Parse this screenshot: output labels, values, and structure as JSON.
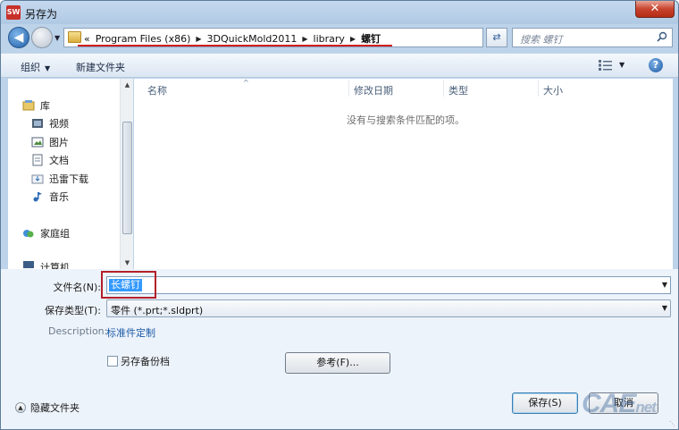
{
  "window": {
    "title": "另存为",
    "app_icon": "SW",
    "close_glyph": "✕"
  },
  "address": {
    "chevron": "«",
    "crumbs": [
      "Program Files (x86)",
      "3DQuickMold2011",
      "library",
      "螺钉"
    ],
    "search_placeholder": "搜索 螺钉"
  },
  "toolbar": {
    "organize_label": "组织",
    "new_folder_label": "新建文件夹",
    "help_glyph": "?"
  },
  "nav": {
    "items": [
      {
        "label": "库",
        "icon": "library-icon"
      },
      {
        "label": "视频",
        "icon": "video-icon"
      },
      {
        "label": "图片",
        "icon": "pictures-icon"
      },
      {
        "label": "文档",
        "icon": "documents-icon"
      },
      {
        "label": "迅雷下载",
        "icon": "download-folder-icon"
      },
      {
        "label": "音乐",
        "icon": "music-icon"
      },
      {
        "label": "家庭组",
        "icon": "homegroup-icon"
      },
      {
        "label": "计算机",
        "icon": "computer-icon"
      }
    ]
  },
  "files": {
    "columns": [
      "名称",
      "修改日期",
      "类型",
      "大小"
    ],
    "empty_message": "没有与搜索条件匹配的项。"
  },
  "form": {
    "filename_label": "文件名(N):",
    "filename_value": "长螺钉",
    "type_label": "保存类型(T):",
    "type_value": "零件 (*.prt;*.sldprt)",
    "description_label": "Description:",
    "description_value": "标准件定制",
    "backup_label": "另存备份档",
    "backup_checked": false,
    "browse_label": "参考(F)...",
    "hide_folders_label": "隐藏文件夹",
    "save_label": "保存(S)",
    "cancel_label": "取消"
  },
  "watermark": {
    "main": "CAE",
    "suffix": "net"
  },
  "colors": {
    "selection": "#3399ff",
    "annotation_red": "#b3202a",
    "link_blue": "#1c5aa6"
  }
}
